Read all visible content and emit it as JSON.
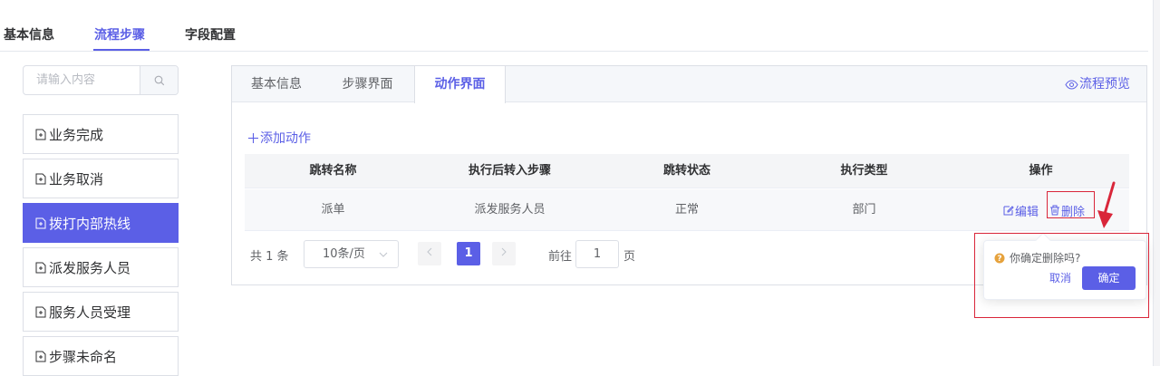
{
  "top_tabs": [
    "基本信息",
    "流程步骤",
    "字段配置"
  ],
  "search": {
    "placeholder": "请输入内容"
  },
  "steps": [
    "业务完成",
    "业务取消",
    "拨打内部热线",
    "派发服务人员",
    "服务人员受理",
    "步骤未命名"
  ],
  "inner_tabs": [
    "基本信息",
    "步骤界面",
    "动作界面"
  ],
  "preview_label": "流程预览",
  "add_action_label": "添加动作",
  "table": {
    "headers": [
      "跳转名称",
      "执行后转入步骤",
      "跳转状态",
      "执行类型",
      "操作"
    ],
    "rows": [
      {
        "name": "派单",
        "next_step": "派发服务人员",
        "status": "正常",
        "type": "部门"
      }
    ],
    "edit_label": "编辑",
    "delete_label": "删除"
  },
  "pagination": {
    "total": "共 1 条",
    "page_size": "10条/页",
    "current_page": "1",
    "goto_prefix": "前往",
    "goto_value": "1",
    "goto_suffix": "页"
  },
  "popconfirm": {
    "message": "你确定删除吗?",
    "cancel_label": "取消",
    "confirm_label": "确定"
  },
  "colors": {
    "primary": "#5b5fe6",
    "annotation": "#d9263a",
    "warning": "#e6a23c"
  }
}
